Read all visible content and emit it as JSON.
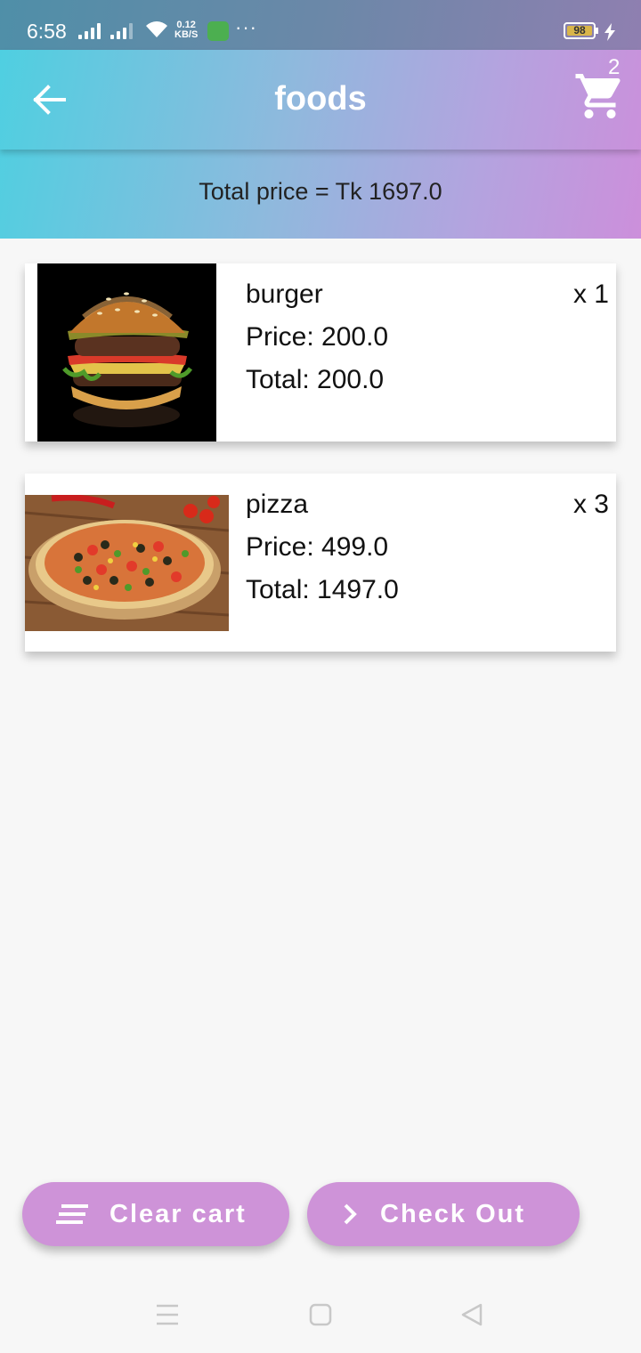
{
  "status_bar": {
    "time": "6:58",
    "speed_value": "0.12",
    "speed_unit": "KB/S",
    "more": "···",
    "battery": "98"
  },
  "app_bar": {
    "title": "foods",
    "cart_badge": "2"
  },
  "summary": {
    "total_price": "Total price = Tk 1697.0"
  },
  "cart_items": [
    {
      "name": "burger",
      "price": "Price: 200.0",
      "total": "Total: 200.0",
      "quantity": "x 1"
    },
    {
      "name": "pizza",
      "price": "Price: 499.0",
      "total": "Total: 1497.0",
      "quantity": "x 3"
    }
  ],
  "actions": {
    "clear_label": "Clear cart",
    "checkout_label": "Check Out"
  },
  "colors": {
    "accent": "#ce93d8",
    "gradient_start": "#4dd0e1",
    "gradient_end": "#cc8fdb"
  }
}
